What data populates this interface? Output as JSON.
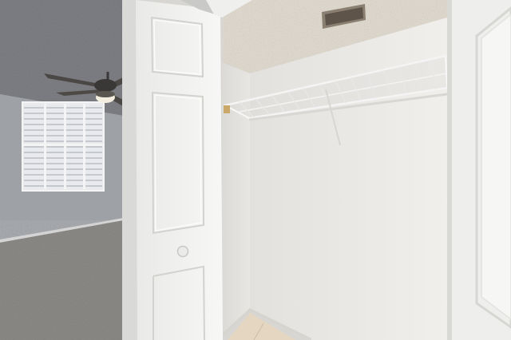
{
  "scene": {
    "description_visible_text": "",
    "palette": {
      "ceiling": "#7f8085",
      "wall_room": "#9ea1a6",
      "carpet": "#8d8b88",
      "door": "#f2f2f1",
      "closet_wall": "#ecebe8",
      "closet_ceiling": "#e3ddd2",
      "tile": "#e4d6c1"
    }
  }
}
